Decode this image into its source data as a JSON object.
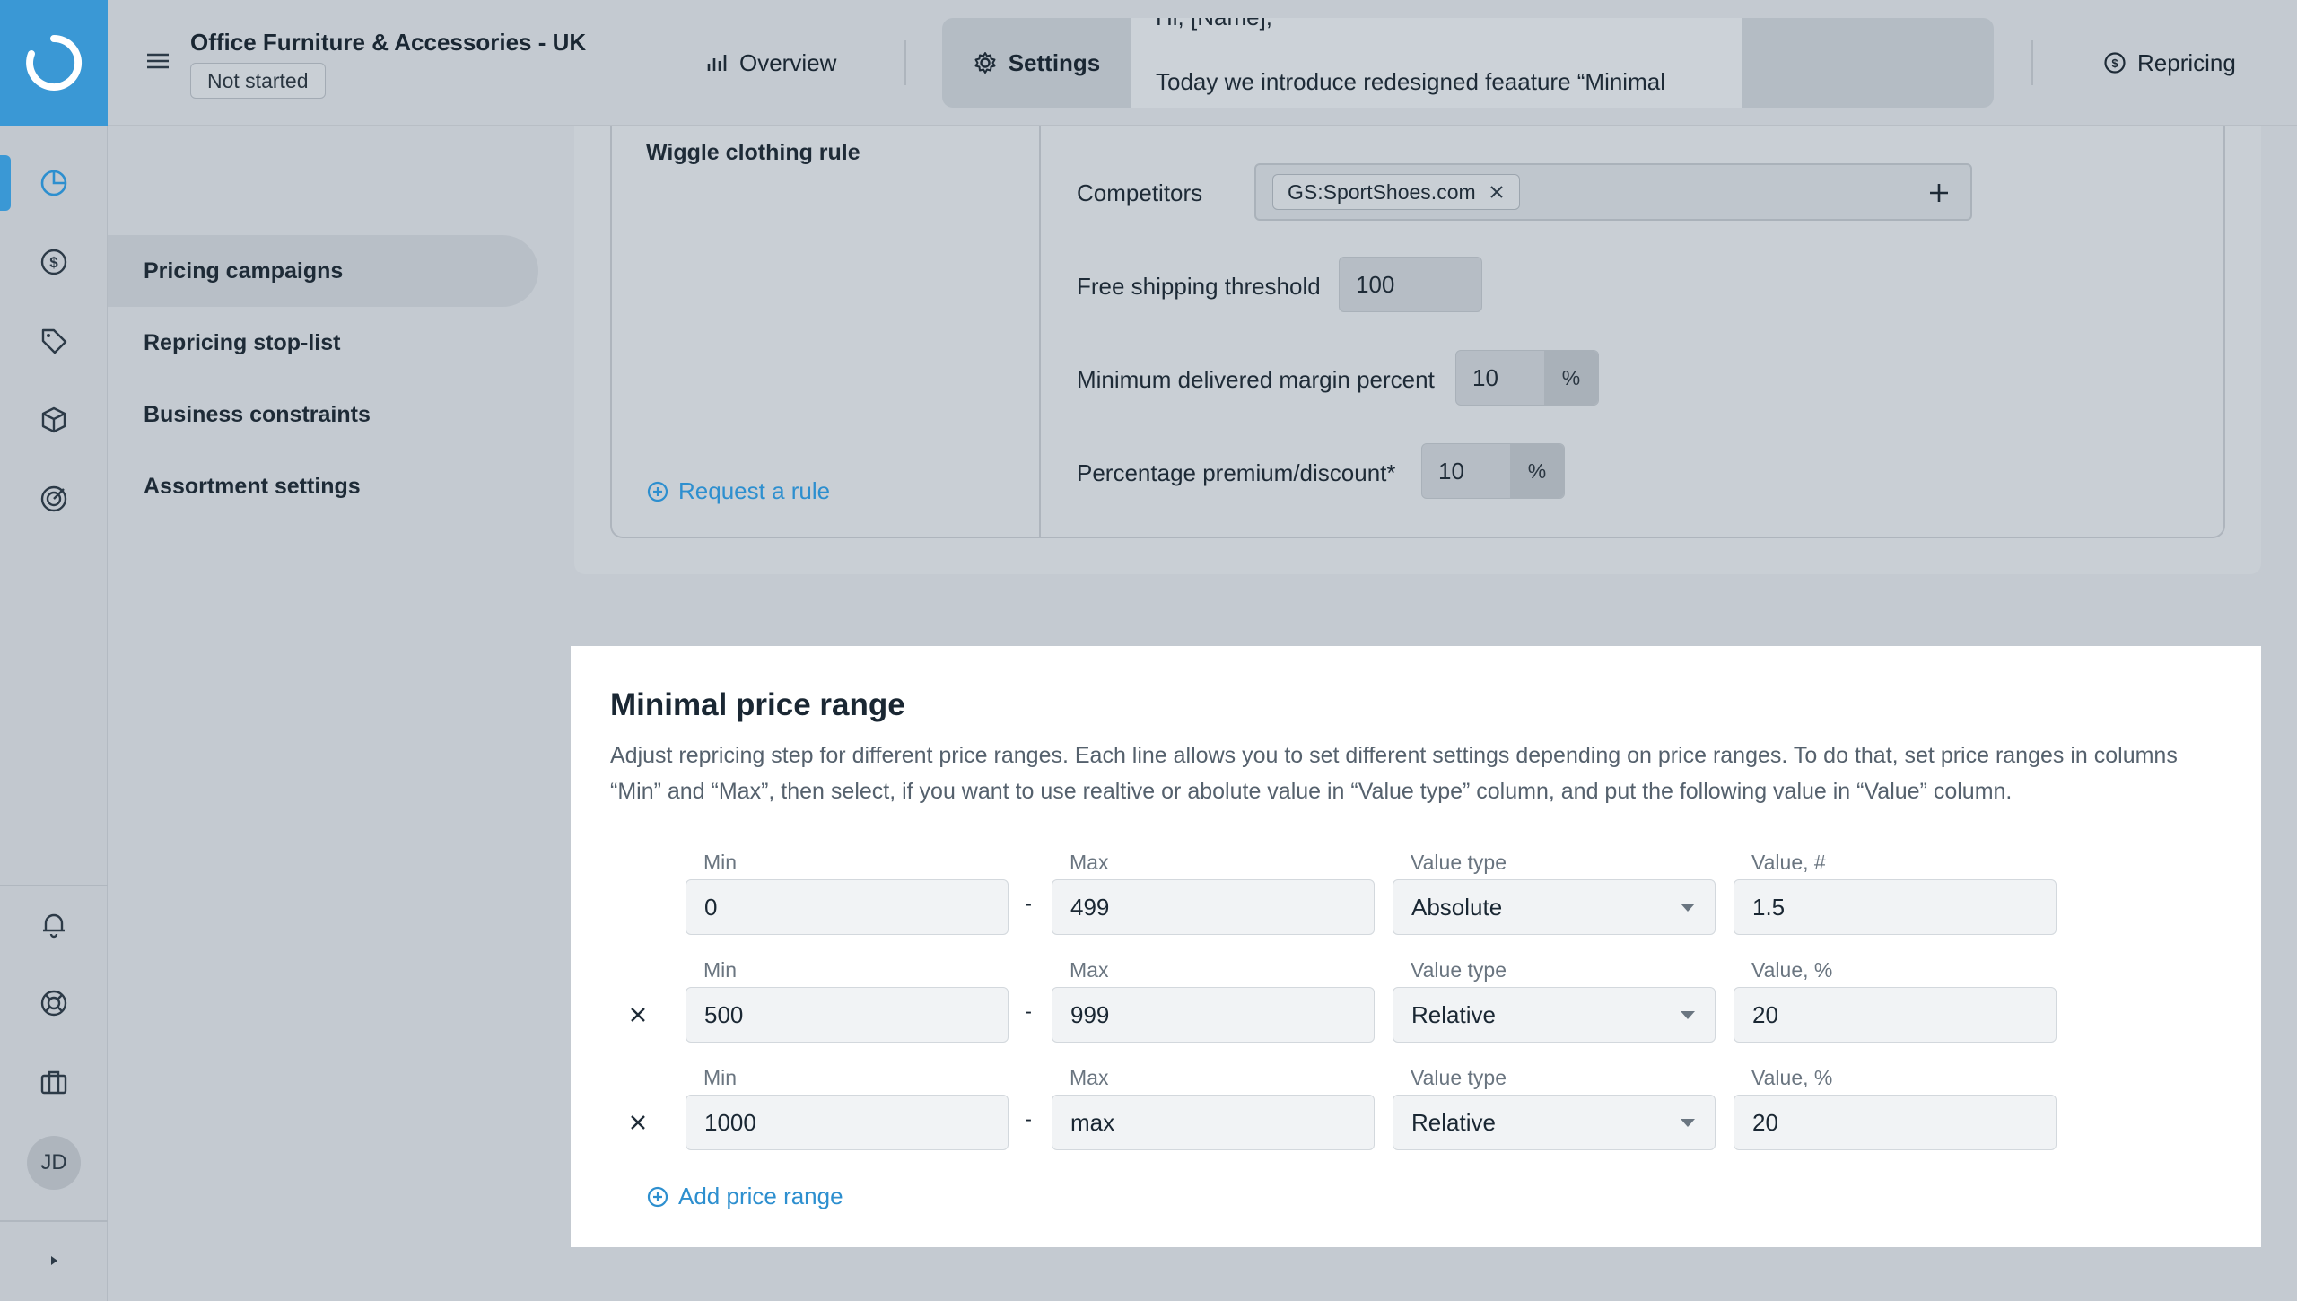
{
  "header": {
    "store_name": "Office Furniture & Accessories - UK",
    "status": "Not started",
    "tabs": {
      "overview": "Overview",
      "settings": "Settings",
      "repricing": "Repricing"
    },
    "banner": {
      "cut_line": "Hi, [Name],",
      "text": "Today we introduce redesigned feaature “Minimal"
    }
  },
  "rail": {
    "avatar_initials": "JD",
    "icons": [
      "dashboard-icon",
      "dollar-icon",
      "tag-icon",
      "box-icon",
      "target-icon",
      "bell-icon",
      "lifebuoy-icon",
      "briefcase-icon",
      "expand-icon"
    ]
  },
  "subnav": {
    "items": [
      {
        "label": "Pricing campaigns",
        "active": true
      },
      {
        "label": "Repricing stop-list",
        "active": false
      },
      {
        "label": "Business constraints",
        "active": false
      },
      {
        "label": "Assortment settings",
        "active": false
      }
    ]
  },
  "rule": {
    "title": "Wiggle clothing rule",
    "request_link": "Request a rule",
    "competitors_label": "Competitors",
    "competitor_chip": "GS:SportShoes.com",
    "free_shipping_label": "Free shipping threshold",
    "free_shipping_value": "100",
    "min_margin_label": "Minimum delivered margin percent",
    "min_margin_value": "10",
    "premium_label": "Percentage premium/discount*",
    "premium_value": "10",
    "percent_suffix": "%"
  },
  "price_range": {
    "title": "Minimal price range",
    "description": "Adjust repricing step for different price ranges. Each line allows you to set different settings depending on price ranges. To do that, set price ranges in columns “Min” and “Max”, then select, if you want to use realtive or abolute value in “Value type” column, and put the following value in “Value” column.",
    "dash": "-",
    "rows": [
      {
        "min_label": "Min",
        "max_label": "Max",
        "type_label": "Value type",
        "value_label": "Value, #",
        "min": "0",
        "max": "499",
        "type": "Absolute",
        "value": "1.5"
      },
      {
        "min_label": "Min",
        "max_label": "Max",
        "type_label": "Value type",
        "value_label": "Value, %",
        "min": "500",
        "max": "999",
        "type": "Relative",
        "value": "20"
      },
      {
        "min_label": "Min",
        "max_label": "Max",
        "type_label": "Value type",
        "value_label": "Value, %",
        "min": "1000",
        "max": "max",
        "type": "Relative",
        "value": "20"
      }
    ],
    "add_link": "Add price range"
  },
  "colors": {
    "accent": "#3a98d5",
    "link": "#2d8fcf",
    "overlay": "#c4cad1"
  }
}
